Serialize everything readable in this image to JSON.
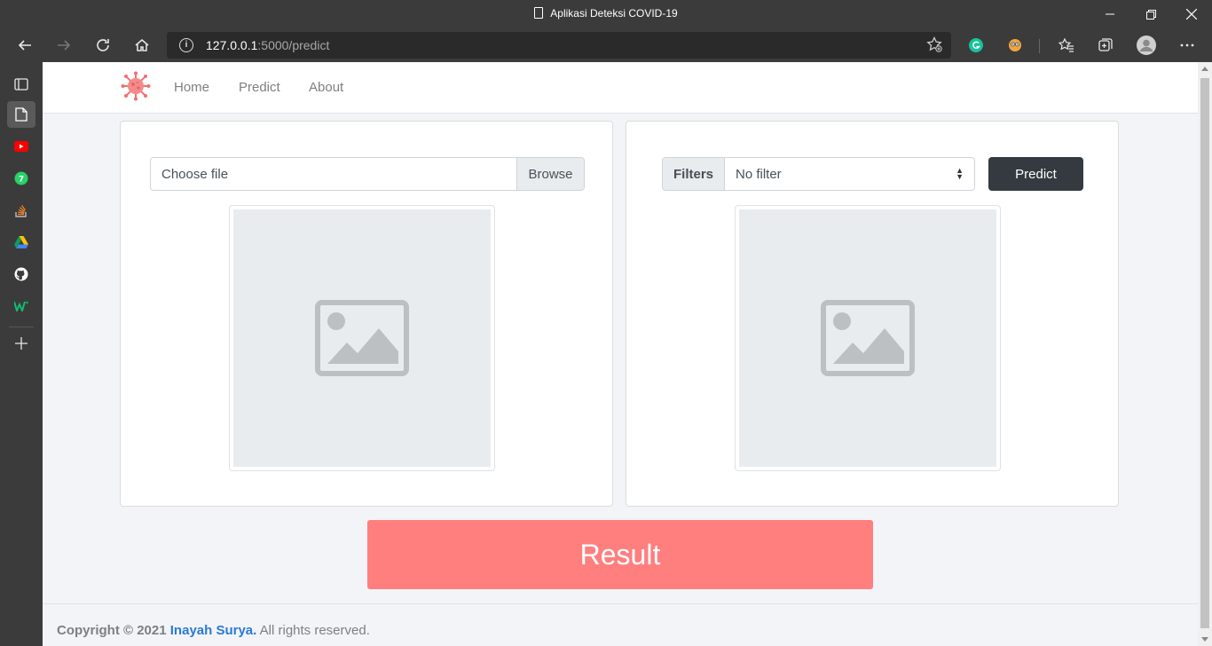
{
  "window": {
    "title": "Aplikasi Deteksi COVID-19"
  },
  "browser": {
    "url_host": "127.0.0.1",
    "url_path": ":5000/predict",
    "icons": [
      "back-icon",
      "forward-icon",
      "refresh-icon",
      "home-icon",
      "info-icon",
      "add-favorite-icon",
      "grammarly-icon",
      "extension-icon",
      "favorites-icon",
      "collections-icon",
      "profile-icon",
      "more-icon"
    ]
  },
  "sidebar": {
    "items": [
      {
        "name": "tab-actions-icon"
      },
      {
        "name": "page-icon"
      },
      {
        "name": "youtube-icon"
      },
      {
        "name": "whatsapp-icon"
      },
      {
        "name": "stackoverflow-icon"
      },
      {
        "name": "google-drive-icon"
      },
      {
        "name": "github-icon"
      },
      {
        "name": "webflow-icon"
      },
      {
        "name": "add-icon"
      }
    ]
  },
  "navbar": {
    "links": [
      "Home",
      "Predict",
      "About"
    ]
  },
  "upload_card": {
    "file_placeholder": "Choose file",
    "browse_label": "Browse"
  },
  "predict_card": {
    "filter_label": "Filters",
    "filter_value": "No filter",
    "predict_label": "Predict"
  },
  "result": {
    "label": "Result"
  },
  "footer": {
    "copyright": "Copyright © 2021",
    "author": "Inayah Surya.",
    "rights": "All rights reserved."
  },
  "colors": {
    "result_bg": "#ff7f7f",
    "predict_btn_bg": "#343a40",
    "author_link": "#2a7ad6"
  }
}
